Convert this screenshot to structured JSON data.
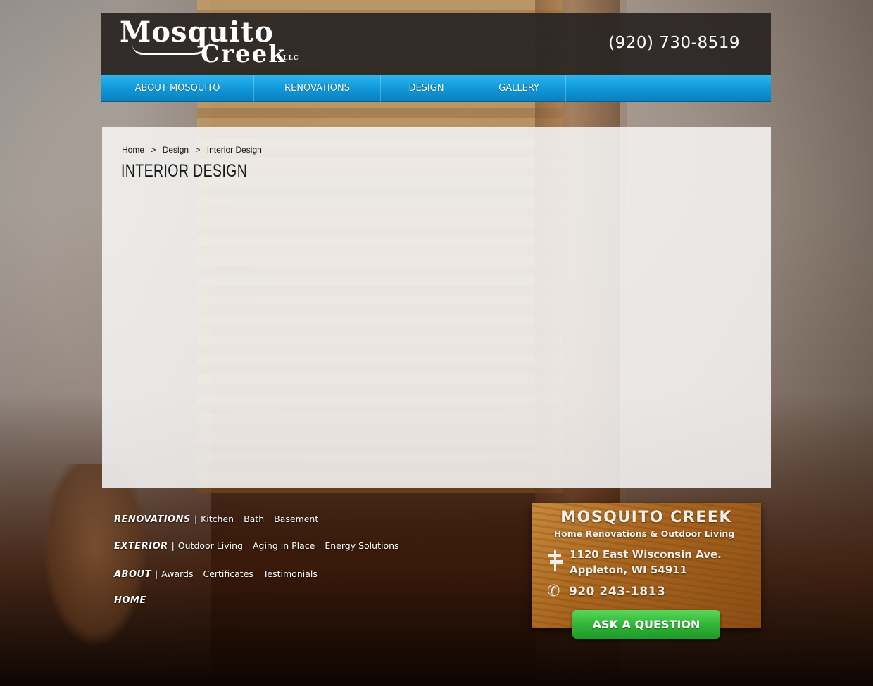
{
  "header": {
    "logo_line1": "Mosquito",
    "logo_line2": "Creek",
    "logo_llc": "LLC",
    "phone": "(920) 730-8519"
  },
  "nav": {
    "items": [
      {
        "label": "ABOUT MOSQUITO"
      },
      {
        "label": "RENOVATIONS"
      },
      {
        "label": "DESIGN"
      },
      {
        "label": "GALLERY"
      }
    ]
  },
  "breadcrumb": {
    "items": [
      "Home",
      "Design",
      "Interior Design"
    ],
    "separator": ">"
  },
  "page": {
    "title": "INTERIOR DESIGN"
  },
  "footer": {
    "rows": [
      {
        "head": "RENOVATIONS",
        "links": [
          "Kitchen",
          "Bath",
          "Basement"
        ]
      },
      {
        "head": "EXTERIOR",
        "links": [
          "Outdoor Living",
          "Aging in Place",
          "Energy Solutions"
        ]
      },
      {
        "head": "ABOUT",
        "links": [
          "Awards",
          "Certificates",
          "Testimonials"
        ]
      },
      {
        "head": "HOME",
        "links": []
      }
    ],
    "pipe": "|"
  },
  "card": {
    "title": "MOSQUITO CREEK",
    "subtitle": "Home Renovations & Outdoor Living",
    "address_line1": "1120 East Wisconsin Ave.",
    "address_line2": "Appleton, WI 54911",
    "phone": "920 243-1813",
    "cta": "ASK A QUESTION",
    "phone_icon_glyph": "✆"
  },
  "colors": {
    "nav_blue": "#1aa3e2",
    "cta_green": "#2fb236",
    "header_dark": "#28241f"
  }
}
